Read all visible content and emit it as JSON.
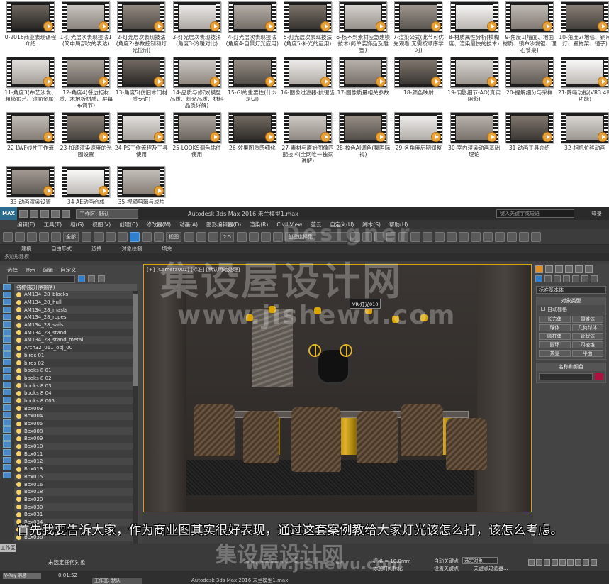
{
  "gallery": {
    "items": [
      "0-2016商业表现课程介绍",
      "1-灯光层次表现技法1(简中局部次的表达)",
      "2-灯光层次表现技法(角度2-参数控制和灯光控制)",
      "3-灯光层次表现技法(角度3-冷暖对比)",
      "4-灯光层次表现技法(角度4-自景灯光应用)",
      "5-灯光层次表现技法(角度5-补光的运用)",
      "6-核不到素材应急建模技术(简单装饰品及雕塑)",
      "7-渲染公式(此节可优先观看,无需按顺序学习)",
      "8-材质属性分析(模糊度、渲染最快的技术)",
      "9-角度1(墙面、地面材质、镜布沙发锟、理石餐桌)",
      "10-角度2(地毯、铜吊灯、置物架、镜子)",
      "11-角度3(布艺沙发、粗糙布艺、镜面金属)",
      "12-角度4(餐边柜材质、木地板材质、屏幕布调节)",
      "13-角度5(仿旧木门材质专讲)",
      "14-品质与修改(模型品质、灯光品质、材料品质详解)",
      "15-GI的重要性(什么是GI)",
      "16-图像过滤器-抗锯齿",
      "17-图像质量相关参数",
      "18-颜色映射",
      "19-阴影细节-AO(真实阴影)",
      "20-提解细分与采样",
      "21-降噪功能(VR3.4新功能)",
      "22-LWF线性工作流",
      "23-加速渲染速度的光图设置",
      "24-PS工作流程及工具使用",
      "25-LOOKS调色插件使用",
      "26-效果图质感细化",
      "27-素材与原始图像匹配技术(全网唯一独家讲解)",
      "28-校色AI调色(泵国际视)",
      "29-各角度后期润整",
      "30-室内浸染动画基础理论",
      "31-动画工具介绍",
      "32-相机位移动画",
      "33-动画渲染设置",
      "34-AE动画合成",
      "35-视频剪辑与成片"
    ]
  },
  "app": {
    "logo": "MAX",
    "workspace": "工作区: 默认",
    "title": "Autodesk 3ds Max 2016    未兰模型1.max",
    "search_placeholder": "键入关键字或短语",
    "login": "登录",
    "menu": [
      "编辑(E)",
      "工具(T)",
      "组(G)",
      "视图(V)",
      "创建(C)",
      "修改器(M)",
      "动画(A)",
      "图形编辑器(D)",
      "渲染(R)",
      "Civil View",
      "蓝云",
      "自定义(U)",
      "脚本(S)",
      "帮助(H)"
    ],
    "toolbar": {
      "filter": "全部",
      "view": "视图",
      "snap": "2.5",
      "selection_set": "创建选择集"
    },
    "ribbon": [
      "建模",
      "自由形式",
      "选择",
      "对象绘制",
      "填充"
    ],
    "subribbon": "多边形建模",
    "explorer": {
      "menu": [
        "选择",
        "显示",
        "编辑",
        "自定义"
      ],
      "header": "名称(按升序排序)",
      "rows": [
        "AM134_28_blocks",
        "AM134_28_hull",
        "AM134_28_masts",
        "AM134_28_ropes",
        "AM134_28_sails",
        "AM134_28_stand",
        "AM134_28_stand_metal",
        "Arch32_011_obj_00",
        "birds 01",
        "birds 02",
        "books 8 01",
        "books 8 02",
        "books 8 03",
        "books 8 04",
        "books 8 005",
        "Box003",
        "Box004",
        "Box005",
        "Box008",
        "Box009",
        "Box010",
        "Box011",
        "Box012",
        "Box013",
        "Box015",
        "Box016",
        "Box018",
        "Box020",
        "Box030",
        "Box031",
        "Box034",
        "Box035",
        "Box036"
      ]
    },
    "viewport": {
      "label": "[+] [Camera001] [标准] [默认明暗处理]",
      "tag": "VR-灯光010"
    },
    "command_panel": {
      "dropdown": "标准基本体",
      "object_type_title": "对象类型",
      "autogrid": "自动栅格",
      "buttons": [
        "长方体",
        "圆锥体",
        "球体",
        "几何球体",
        "圆柱体",
        "管状体",
        "圆环",
        "四棱锥",
        "茶壶",
        "平面"
      ],
      "name_color_title": "名称和颜色"
    },
    "status": {
      "workspace_tag": "工作区",
      "prompt": "未选定任何对象",
      "grid": "栅格 = 10.0mm",
      "add_tag": "添加时间标记",
      "auto_key": "自动关键点",
      "set_key": "设置关键点",
      "selected": "选定对象",
      "key_filter": "关键点过滤器..."
    }
  },
  "subtitle": "首先我要告诉大家，作为商业图其实很好表现，通过这套案例教给大家灯光该怎么打，该怎么考虑。",
  "watermark": {
    "brand_en": "Designer",
    "brand_cn": "集设屋设计网",
    "url": "www.jishewu.com"
  },
  "second_window": {
    "taskbar": "V-Ray 消息",
    "timer": "0:01:52",
    "workspace": "工作区: 默认",
    "title": "Autodesk 3ds Max 2016    未兰模型1.max"
  },
  "colors": {
    "selection_border": "#d9a400",
    "accent_blue": "#2e7fcf",
    "bulb": "#f3d36a"
  }
}
